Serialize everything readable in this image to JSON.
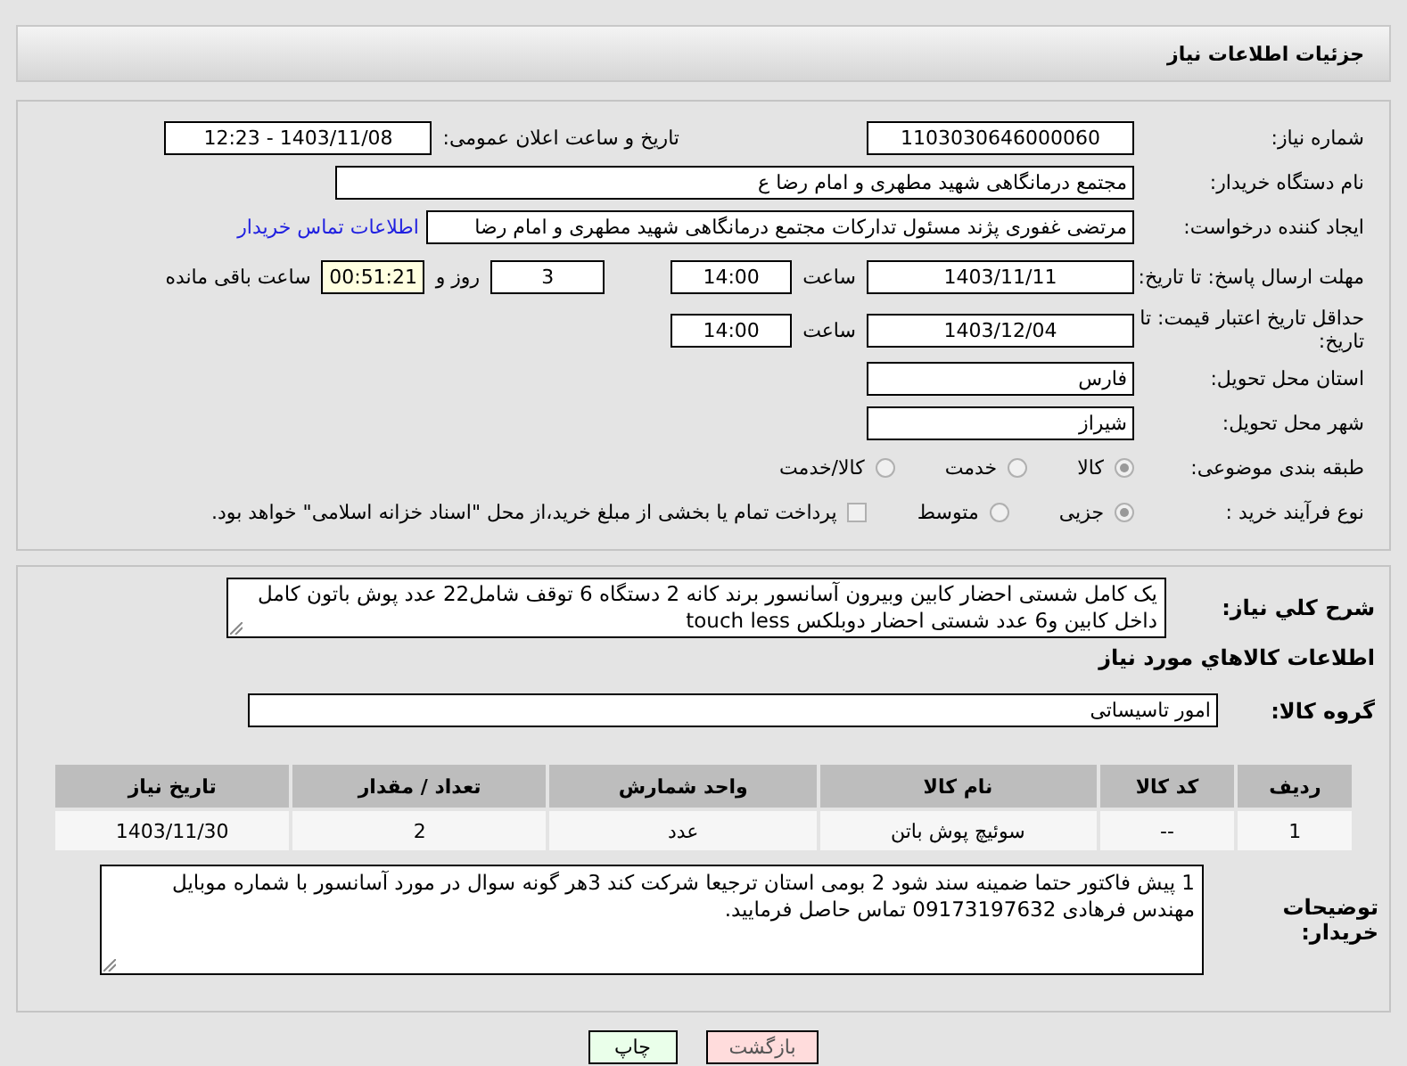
{
  "header": {
    "title": "جزئیات اطلاعات نیاز"
  },
  "form": {
    "need_number": {
      "label": "شماره نیاز:",
      "value": "1103030646000060"
    },
    "announce": {
      "label": "تاریخ و ساعت اعلان عمومی:",
      "value": "1403/11/08 - 12:23"
    },
    "buyer_org": {
      "label": "نام دستگاه خریدار:",
      "value": "مجتمع درمانگاهی شهید مطهری و امام رضا  ع"
    },
    "requester": {
      "label": "ایجاد کننده درخواست:",
      "value": "مرتضی غفوری پژند مسئول تدارکات مجتمع درمانگاهی شهید مطهری و امام رضا",
      "link": "اطلاعات تماس خریدار"
    },
    "reply_deadline": {
      "label": "مهلت ارسال پاسخ: تا تاریخ:",
      "date": "1403/11/11",
      "time_label": "ساعت",
      "time": "14:00",
      "days": "3",
      "days_label": "روز و",
      "remaining": "00:51:21",
      "remaining_label": "ساعت باقی مانده"
    },
    "price_validity": {
      "label": "حداقل تاریخ اعتبار قیمت: تا تاریخ:",
      "date": "1403/12/04",
      "time_label": "ساعت",
      "time": "14:00"
    },
    "province": {
      "label": "استان محل تحویل:",
      "value": "فارس"
    },
    "city": {
      "label": "شهر محل تحویل:",
      "value": "شیراز"
    },
    "category": {
      "label": "طبقه بندی موضوعی:",
      "options": [
        {
          "label": "کالا",
          "selected": true
        },
        {
          "label": "خدمت",
          "selected": false
        },
        {
          "label": "کالا/خدمت",
          "selected": false
        }
      ]
    },
    "process": {
      "label": "نوع فرآیند خرید :",
      "options": [
        {
          "label": "جزیی",
          "selected": true
        },
        {
          "label": "متوسط",
          "selected": false
        }
      ],
      "payment": {
        "label": "پرداخت تمام یا بخشی از مبلغ خرید،از محل \"اسناد خزانه اسلامی\" خواهد بود.",
        "checked": false
      }
    }
  },
  "details": {
    "description": {
      "label": "شرح کلي نياز:",
      "text": "یک کامل شستی احضار کابین وبیرون آسانسور برند کانه 2 دستگاه 6 توقف شامل22 عدد پوش باتون کامل داخل کابین و6 عدد شستی احضار دوبلکس touch less"
    },
    "items_heading": "اطلاعات کالاهاي مورد نياز",
    "group": {
      "label": "گروه کالا:",
      "value": "امور تاسیساتی"
    },
    "table": {
      "columns": [
        "ردیف",
        "کد کالا",
        "نام کالا",
        "واحد شمارش",
        "تعداد / مقدار",
        "تاریخ نیاز"
      ],
      "rows": [
        [
          "1",
          "--",
          "سوئیچ پوش باتن",
          "عدد",
          "2",
          "1403/11/30"
        ]
      ]
    },
    "buyer_notes": {
      "label": "توضیحات خریدار:",
      "text": "1 پیش فاکتور حتما ضمینه سند شود 2 بومی استان ترجیعا شرکت کند 3هر گونه سوال در مورد آسانسور با شماره موبایل مهندس فرهادی 09173197632 تماس حاصل فرمایید."
    }
  },
  "buttons": [
    {
      "label": "بازگشت",
      "kind": "back"
    },
    {
      "label": "چاپ",
      "kind": "print"
    }
  ]
}
